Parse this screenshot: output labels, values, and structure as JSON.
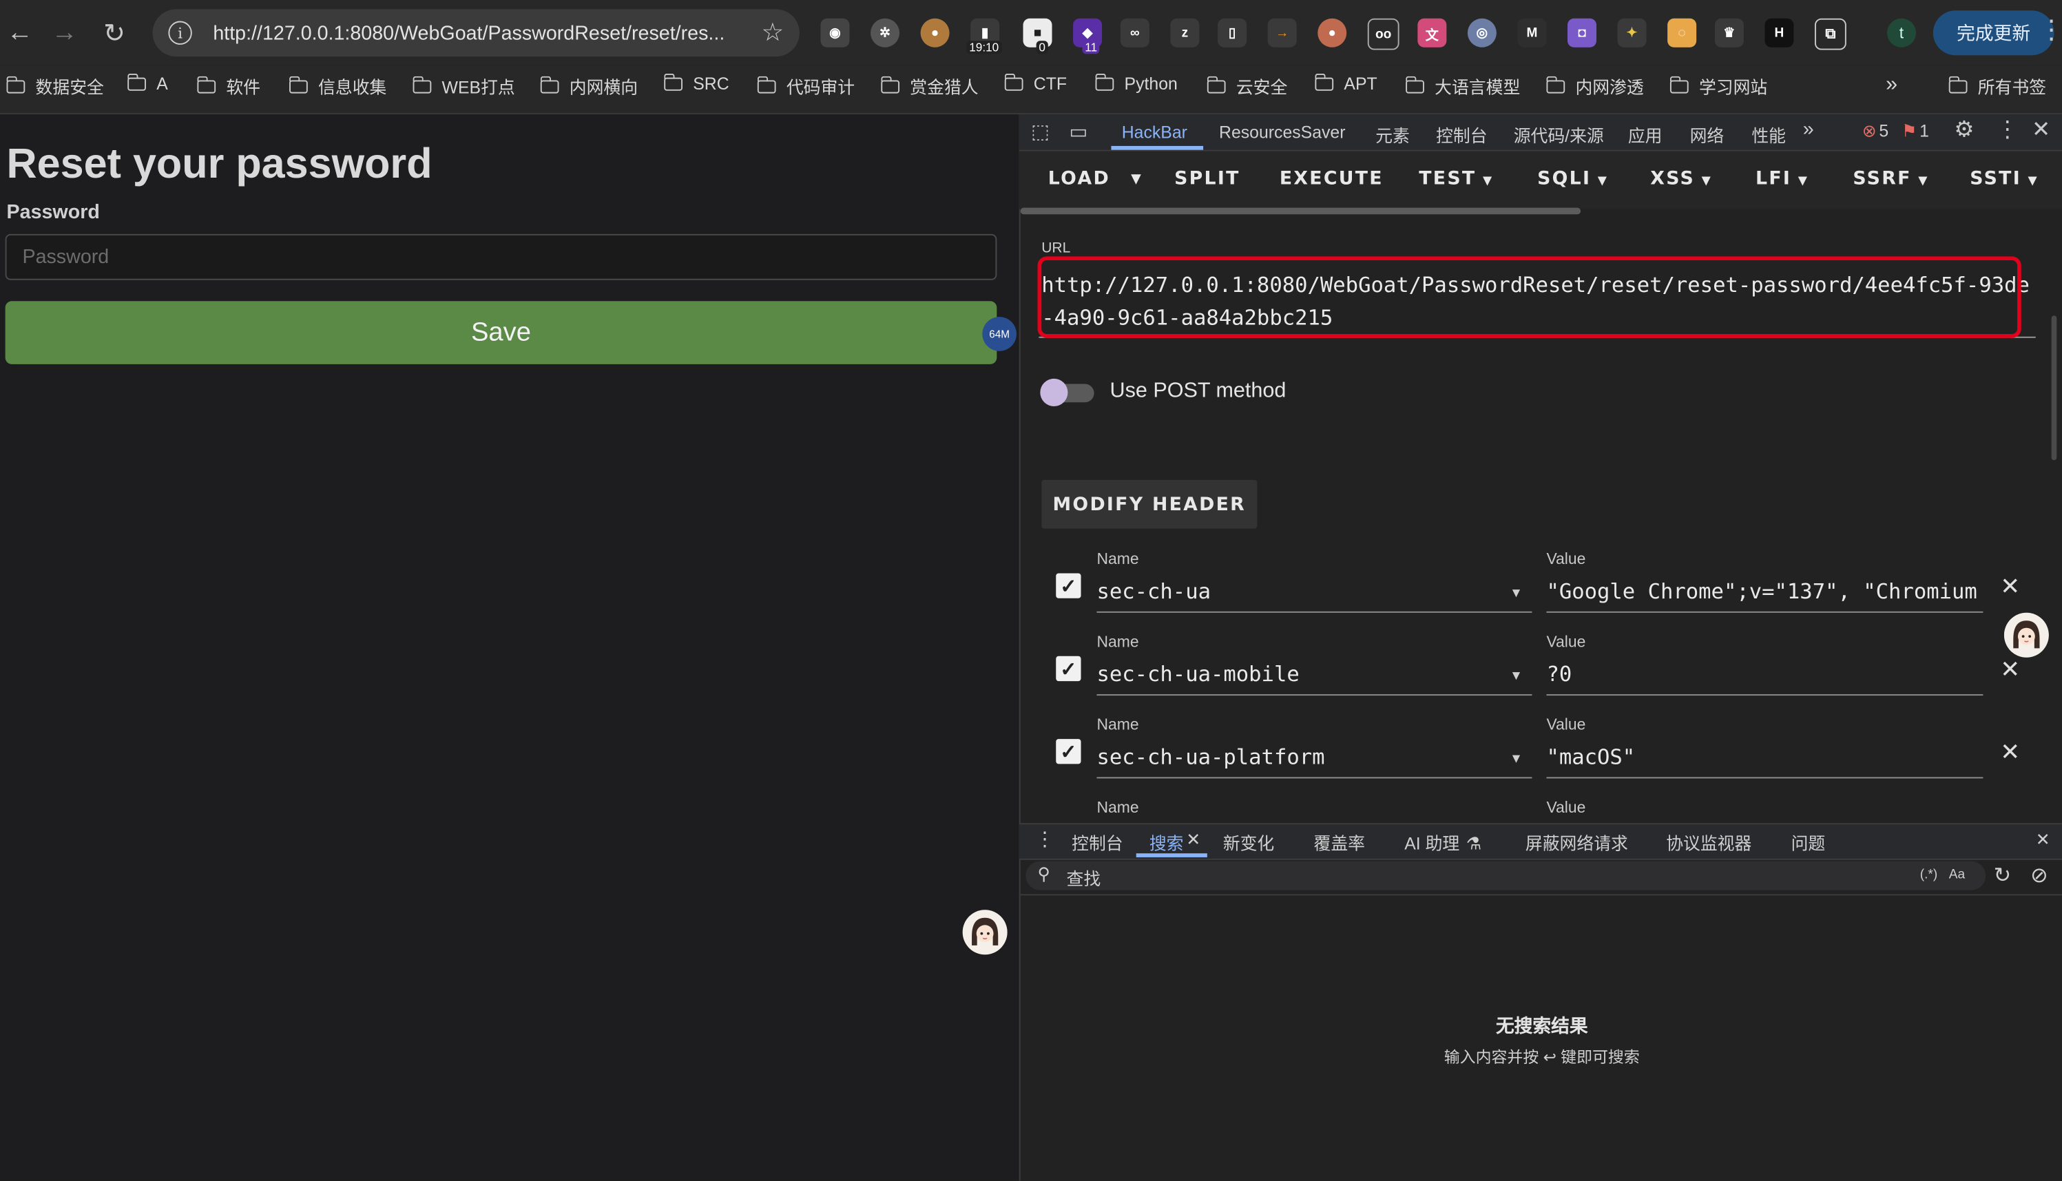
{
  "browser": {
    "url": "http://127.0.0.1:8080/WebGoat/PasswordReset/reset/res...",
    "extension_badges": [
      "19:10",
      "0",
      "11"
    ],
    "profile_initial": "t",
    "update_button": "完成更新"
  },
  "bookmarks": [
    "数据安全",
    "A",
    "软件",
    "信息收集",
    "WEB打点",
    "内网横向",
    "SRC",
    "代码审计",
    "赏金猎人",
    "CTF",
    "Python",
    "云安全",
    "APT",
    "大语言模型",
    "内网渗透",
    "学习网站"
  ],
  "bookmarks_more": "»",
  "bookmarks_all": "所有书签",
  "page": {
    "title": "Reset your password",
    "password_label": "Password",
    "password_placeholder": "Password",
    "save_button": "Save",
    "memory_badge": "64M"
  },
  "devtools": {
    "tabs": [
      "HackBar",
      "ResourcesSaver",
      "元素",
      "控制台",
      "源代码/来源",
      "应用",
      "网络",
      "性能"
    ],
    "active_tab": "HackBar",
    "errors": "5",
    "warnings": "1"
  },
  "hackbar": {
    "buttons": [
      "LOAD",
      "SPLIT",
      "EXECUTE",
      "TEST",
      "SQLI",
      "XSS",
      "LFI",
      "SSRF",
      "SSTI"
    ],
    "url_label": "URL",
    "url_value": "http://127.0.0.1:8080/WebGoat/PasswordReset/reset/reset-password/4ee4fc5f-93de-4a90-9c61-aa84a2bbc215",
    "post_label": "Use POST method",
    "modify_header": "MODIFY HEADER",
    "name_label": "Name",
    "value_label": "Value",
    "headers": [
      {
        "name": "sec-ch-ua",
        "value": "\"Google Chrome\";v=\"137\", \"Chromium"
      },
      {
        "name": "sec-ch-ua-mobile",
        "value": "?0"
      },
      {
        "name": "sec-ch-ua-platform",
        "value": "\"macOS\""
      }
    ]
  },
  "drawer": {
    "tabs": [
      "控制台",
      "搜索",
      "新变化",
      "覆盖率",
      "AI 助理",
      "屏蔽网络请求",
      "协议监视器",
      "问题"
    ],
    "active_tab": "搜索",
    "search_placeholder": "查找",
    "regex_toggle": "(.*)",
    "case_toggle": "Aa",
    "no_results_title": "无搜索结果",
    "no_results_hint": "输入内容并按 ↩ 键即可搜索"
  }
}
